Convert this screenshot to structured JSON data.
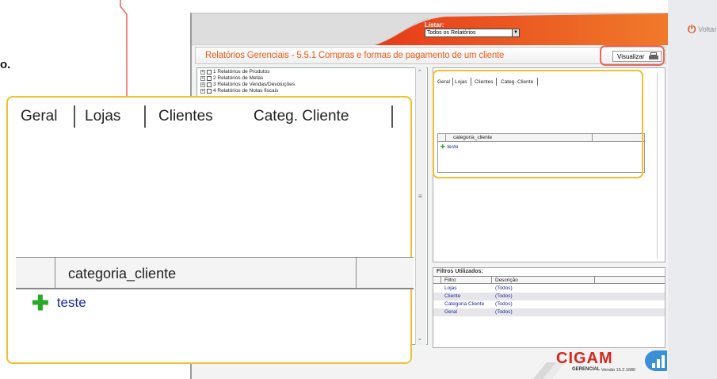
{
  "listar": {
    "label": "Listar:",
    "selected": "Todos os Relatórios"
  },
  "header": {
    "title": "Relatórios Gerenciais - 5.5.1 Compras e formas de pagamento de um cliente",
    "visualizar_label": "Visualizar"
  },
  "voltar_label": "Voltar",
  "partial_left_text": "o.",
  "tree": {
    "items": [
      {
        "label": "1 Relatórios de Produtos"
      },
      {
        "label": "2 Relatórios de Metas"
      },
      {
        "label": "3 Relatórios de Vendas/Devoluções"
      },
      {
        "label": "4 Relatórios de Notas fiscais"
      }
    ]
  },
  "tabs": [
    {
      "label": "Geral"
    },
    {
      "label": "Lojas"
    },
    {
      "label": "Clientes"
    },
    {
      "label": "Categ. Cliente"
    }
  ],
  "grid": {
    "column": "categoria_cliente",
    "rows": [
      {
        "value": "teste"
      }
    ]
  },
  "filtros": {
    "title": "Filtros Utilizados:",
    "headers": {
      "filtro": "Filtro",
      "descricao": "Descrição"
    },
    "rows": [
      {
        "filtro": "Lojas",
        "descricao": "(Todos)"
      },
      {
        "filtro": "Cliente",
        "descricao": "(Todos)"
      },
      {
        "filtro": "Categoria Cliente",
        "descricao": "(Todos)"
      },
      {
        "filtro": "Geral",
        "descricao": "(Todos)"
      }
    ]
  },
  "logo": {
    "brand": "CIGAM",
    "sub": "GERENCIAL",
    "version": "Versão 15.2.1680"
  },
  "colors": {
    "accent": "#e85f1c",
    "highlight": "#f0c030",
    "callout": "#e9645a",
    "brand_red": "#d7261e",
    "link_blue": "#1a2a9a"
  }
}
